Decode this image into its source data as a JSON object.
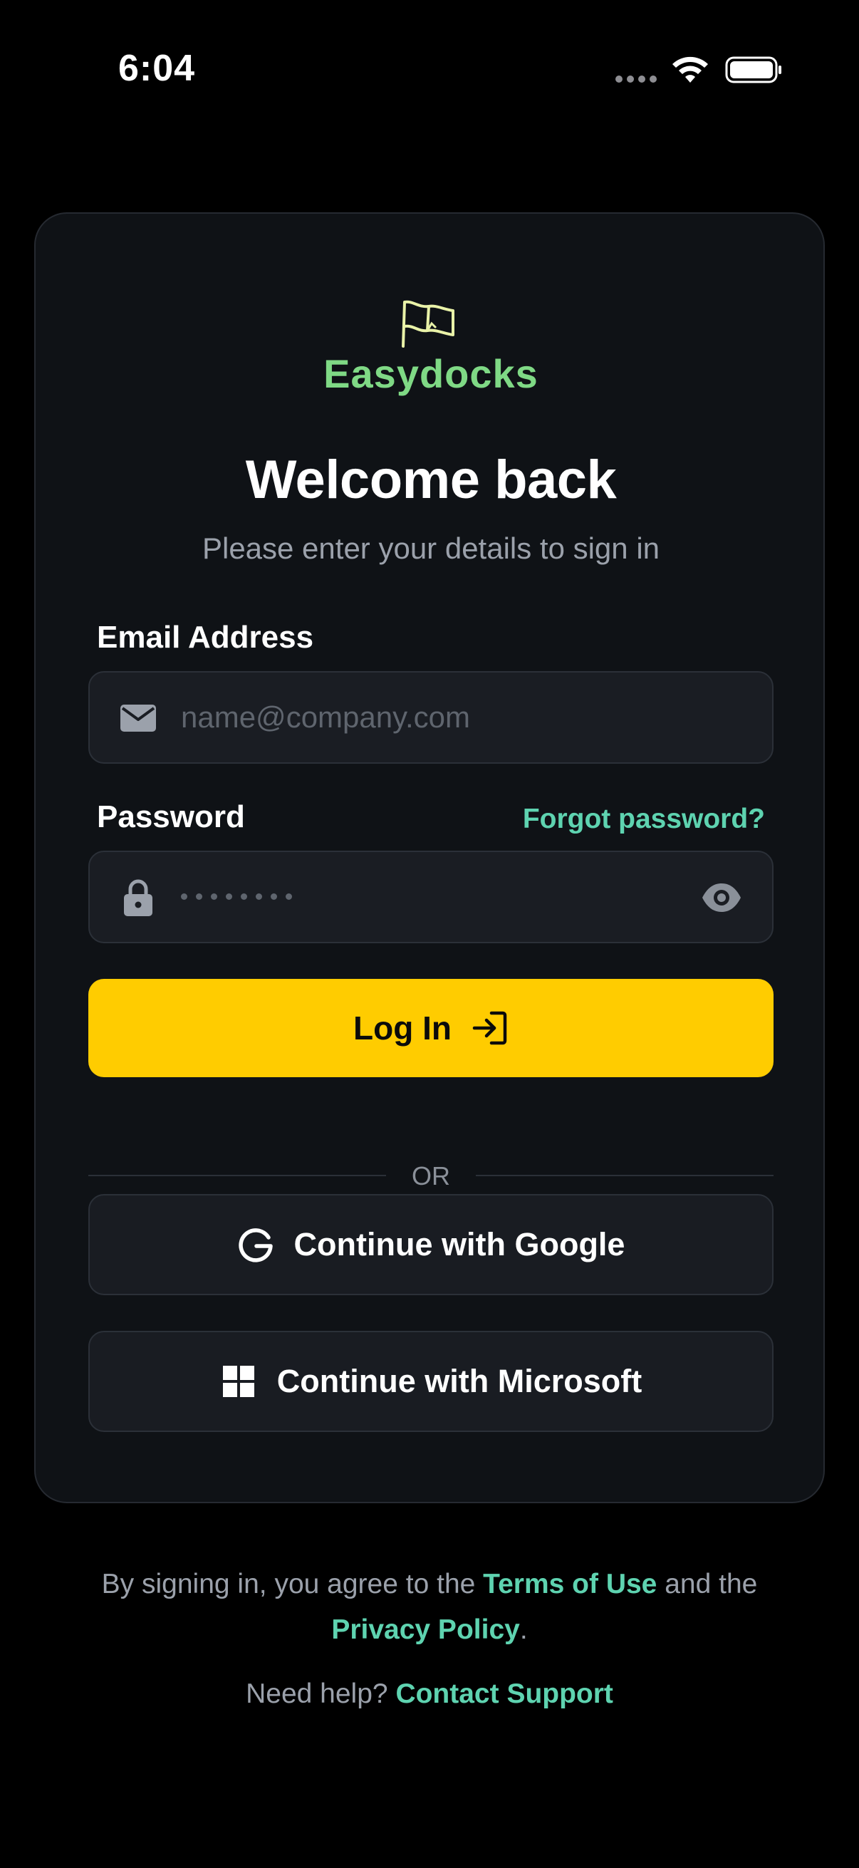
{
  "status_bar": {
    "time": "6:04"
  },
  "brand": {
    "name": "Easydocks",
    "logo_icon": "flag-icon",
    "color": "#7fd985"
  },
  "header": {
    "title": "Welcome back",
    "subtitle": "Please enter your details to sign in"
  },
  "email": {
    "label": "Email Address",
    "placeholder": "name@company.com",
    "value": "",
    "icon": "mail-icon"
  },
  "password": {
    "label": "Password",
    "forgot_label": "Forgot password?",
    "masked_value": "••••••••",
    "icon": "lock-icon",
    "toggle_icon": "eye-icon"
  },
  "login_button": {
    "label": "Log In",
    "icon": "login-arrow-icon",
    "color": "#ffcc00"
  },
  "divider": {
    "label": "OR"
  },
  "sso": {
    "google_label": "Continue with Google",
    "google_icon": "google-icon",
    "microsoft_label": "Continue with Microsoft",
    "microsoft_icon": "microsoft-icon"
  },
  "footer": {
    "terms_prefix": "By signing in, you agree to the",
    "terms_link": "Terms of Use",
    "terms_middle": "and the",
    "privacy_link": "Privacy Policy",
    "terms_suffix": ".",
    "help_prefix": "Need help?",
    "support_link": "Contact Support",
    "link_color": "#5ed3b0"
  }
}
